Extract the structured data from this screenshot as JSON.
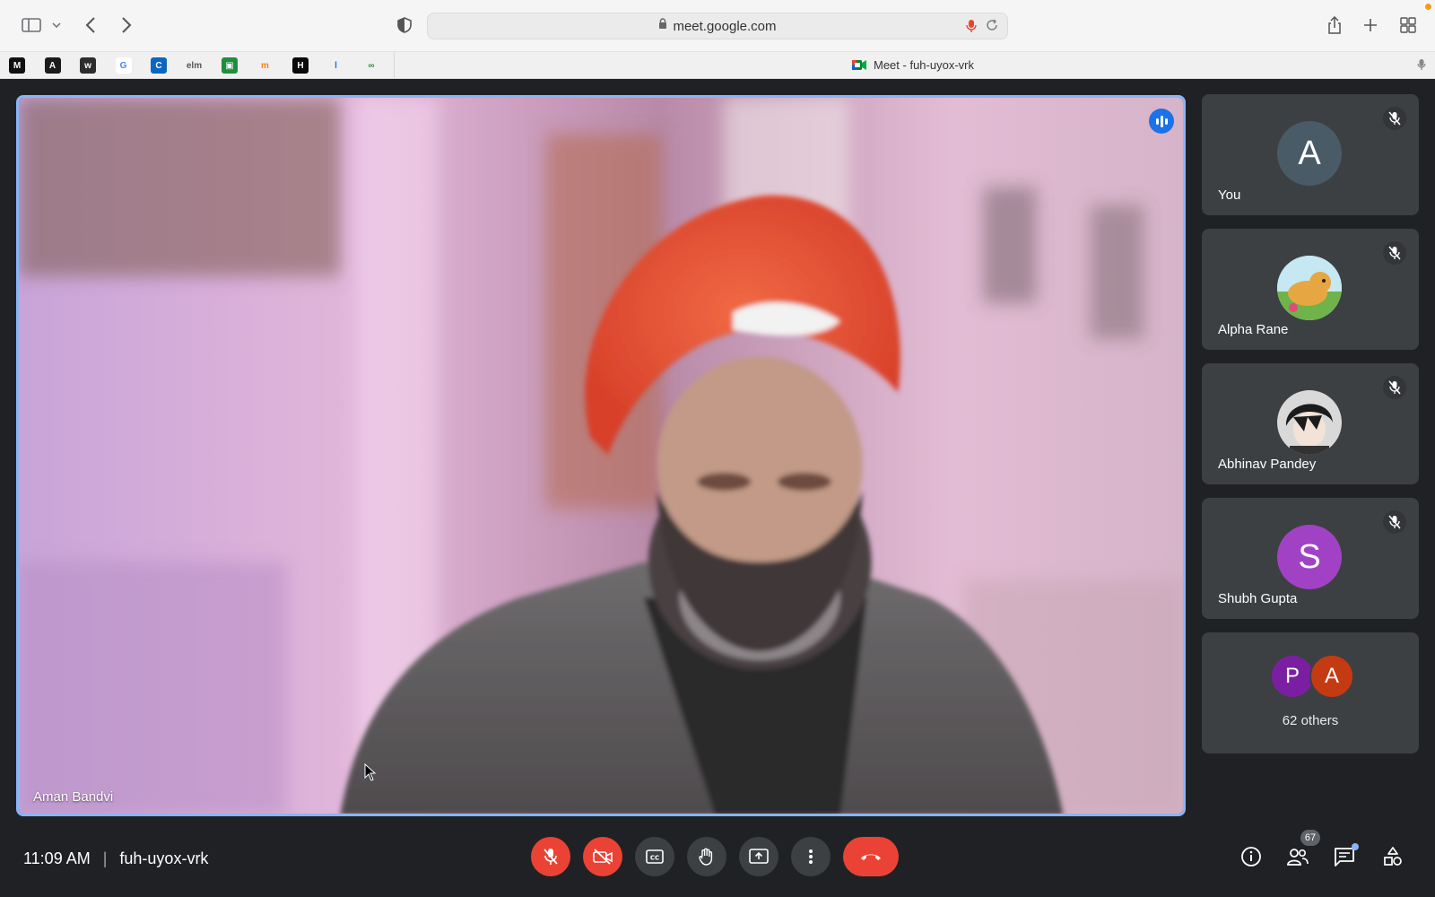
{
  "browser": {
    "url": "meet.google.com",
    "tab_title": "Meet - fuh-uyox-vrk",
    "favorites": [
      {
        "icon": "medium-icon",
        "color": "#111111",
        "glyph": "M"
      },
      {
        "icon": "adobe-icon",
        "color": "#1b1b1b",
        "glyph": "A"
      },
      {
        "icon": "wix-icon",
        "color": "#2d2d2d",
        "glyph": "w"
      },
      {
        "icon": "google-icon",
        "color": "#ffffff",
        "glyph": "G"
      },
      {
        "icon": "c-icon",
        "color": "#0a66c2",
        "glyph": "C"
      },
      {
        "icon": "elm-icon",
        "color": "#f1f0f1",
        "glyph": "elm"
      },
      {
        "icon": "classroom-icon",
        "color": "#1e8e3e",
        "glyph": "▣"
      },
      {
        "icon": "moodle-icon",
        "color": "#f1f0f1",
        "glyph": "m"
      },
      {
        "icon": "hackerrank-icon",
        "color": "#0a0a0a",
        "glyph": "H"
      },
      {
        "icon": "l-icon",
        "color": "#f1f0f1",
        "glyph": "l"
      },
      {
        "icon": "gfg-icon",
        "color": "#f1f0f1",
        "glyph": "∞"
      }
    ]
  },
  "meeting": {
    "time": "11:09 AM",
    "code": "fuh-uyox-vrk",
    "main_speaker": "Aman Bandvi",
    "participant_count": "67"
  },
  "participants": [
    {
      "name": "You",
      "initial": "A",
      "avatar_color": "#4a5b68"
    },
    {
      "name": "Alpha Rane",
      "initial": "",
      "avatar_color": "#b7e2a5"
    },
    {
      "name": "Abhinav Pandey",
      "initial": "",
      "avatar_color": "#2b2b2b"
    },
    {
      "name": "Shubh Gupta",
      "initial": "S",
      "avatar_color": "#a142c4"
    }
  ],
  "others": {
    "label": "62 others",
    "avatars": [
      {
        "initial": "P",
        "color": "#7b1fa2"
      },
      {
        "initial": "A",
        "color": "#c43a12"
      }
    ]
  },
  "colors": {
    "background": "#202124",
    "tile": "#3c4043",
    "accent": "#8ab4f8",
    "danger": "#ea4335"
  }
}
